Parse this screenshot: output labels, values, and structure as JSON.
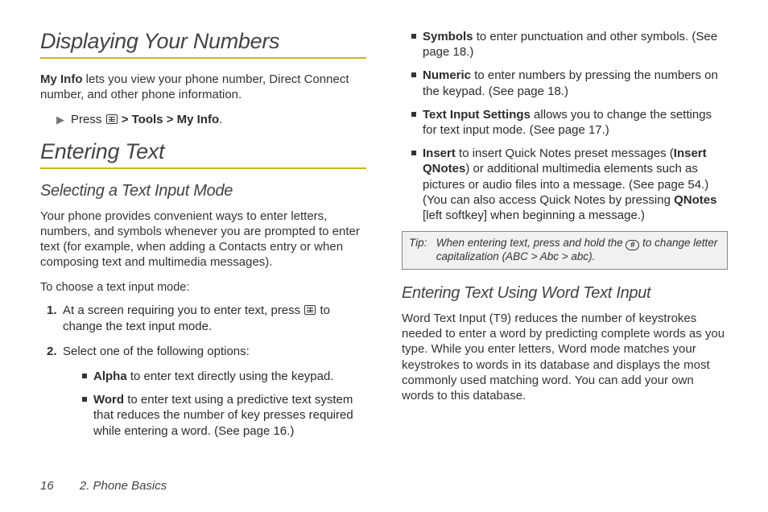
{
  "left": {
    "h1a": "Displaying Your Numbers",
    "p1_strong": "My Info",
    "p1_rest": " lets you view your phone number, Direct Connect number, and other phone information.",
    "instr_press": "Press ",
    "instr_tools": "Tools",
    "instr_myinfo": "My Info",
    "gt": ">",
    "period": ".",
    "h1b": "Entering Text",
    "h2a": "Selecting a Text Input Mode",
    "p2": "Your phone provides convenient ways to enter letters, numbers, and symbols whenever you are prompted to enter text (for example, when adding a Contacts entry or when composing text and multimedia messages).",
    "leadin": "To choose a text input mode:",
    "ol1_n": "1.",
    "ol1_a": "At a screen requiring you to enter text, press ",
    "ol1_b": " to change the text input mode.",
    "ol2_n": "2.",
    "ol2": "Select one of the following options:",
    "ul_alpha_b": "Alpha",
    "ul_alpha_r": " to enter text directly using the keypad.",
    "ul_word_b": "Word",
    "ul_word_r": " to enter text using a predictive text system that reduces the number of key presses required while entering a word. (See page 16.)"
  },
  "right": {
    "ul_sym_b": "Symbols",
    "ul_sym_r": " to enter punctuation and other symbols. (See page 18.)",
    "ul_num_b": "Numeric",
    "ul_num_r": " to enter numbers by pressing the numbers on the keypad. (See page 18.)",
    "ul_tis_b": "Text Input Settings",
    "ul_tis_r": " allows you to change the settings for text input mode. (See page 17.)",
    "ul_ins_b": "Insert",
    "ul_ins_r1": " to insert Quick Notes preset messages (",
    "ul_ins_b2": "Insert QNotes",
    "ul_ins_r2": ") or additional multimedia elements such as pictures or audio files into a message. (See page 54.) (You can also access Quick Notes by pressing ",
    "ul_ins_b3": "QNotes",
    "ul_ins_r3": " [left softkey] when beginning a message.)",
    "tip_label": "Tip:",
    "tip_a": "When entering text, press and hold the ",
    "tip_b": " to change letter capitalization (ABC > Abc > abc).",
    "h2b": "Entering Text Using Word Text Input",
    "p3": "Word Text Input (T9) reduces the number of keystrokes needed to enter a word by predicting complete words as you type. While you enter letters, Word mode matches your keystrokes to words in its database and displays the most commonly used matching word. You can add your own words to this database."
  },
  "footer": {
    "page": "16",
    "section": "2. Phone Basics"
  }
}
